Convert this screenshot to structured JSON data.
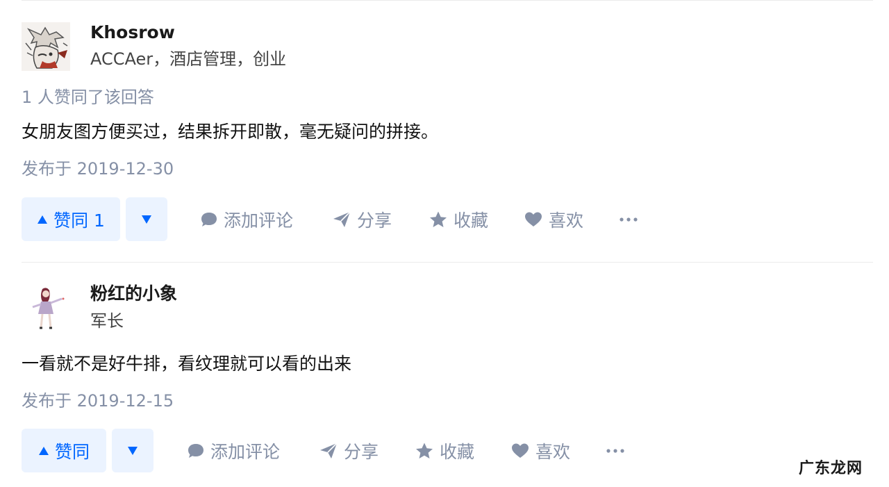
{
  "answers": [
    {
      "author": {
        "name": "Khosrow",
        "bio": "ACCAer，酒店管理，创业"
      },
      "vote_summary": "1 人赞同了该回答",
      "content": "女朋友图方便买过，结果拆开即散，毫无疑问的拼接。",
      "published": "发布于 2019-12-30",
      "actions": {
        "upvote_label": "赞同 1",
        "comment": "添加评论",
        "share": "分享",
        "collect": "收藏",
        "like": "喜欢"
      }
    },
    {
      "author": {
        "name": "粉红的小象",
        "bio": "军长"
      },
      "content": "一看就不是好牛排，看纹理就可以看的出来",
      "published": "发布于 2019-12-15",
      "actions": {
        "upvote_label": "赞同",
        "comment": "添加评论",
        "share": "分享",
        "collect": "收藏",
        "like": "喜欢"
      }
    }
  ],
  "watermark": "广东龙网",
  "colors": {
    "accent": "#0066ff",
    "vote_bg": "#ebf3ff",
    "meta": "#8590a6",
    "text": "#121212"
  },
  "icons": [
    "triangle-up-icon",
    "triangle-down-icon",
    "comment-icon",
    "share-icon",
    "star-icon",
    "heart-icon",
    "more-icon"
  ]
}
